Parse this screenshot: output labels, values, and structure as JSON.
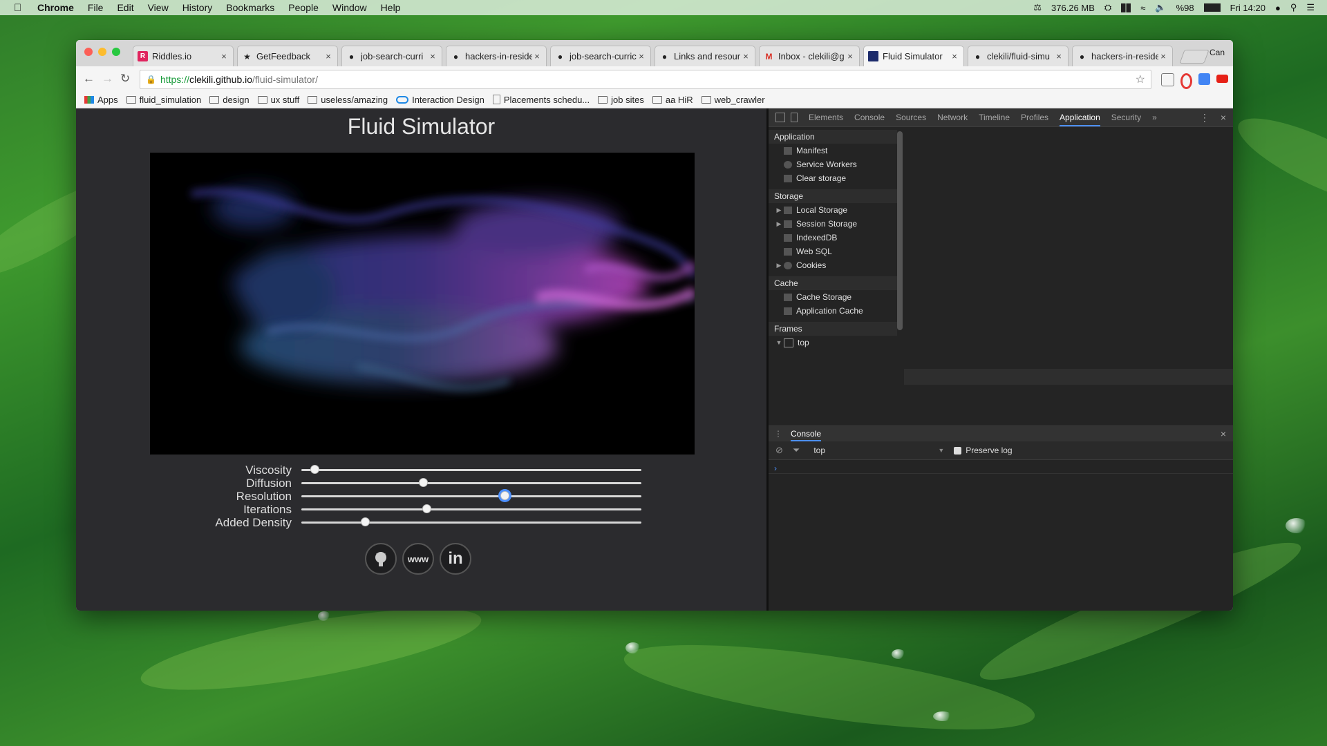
{
  "menubar": {
    "app": "Chrome",
    "items": [
      "File",
      "Edit",
      "View",
      "History",
      "Bookmarks",
      "People",
      "Window",
      "Help"
    ],
    "memory": "376.26 MB",
    "battery": "%98",
    "clock": "Fri 14:20"
  },
  "tabs": [
    {
      "label": "Riddles.io",
      "icon": "riddles-icon"
    },
    {
      "label": "GetFeedback",
      "icon": "star-icon"
    },
    {
      "label": "job-search-curri",
      "icon": "github-icon"
    },
    {
      "label": "hackers-in-reside",
      "icon": "github-icon"
    },
    {
      "label": "job-search-curric",
      "icon": "github-icon"
    },
    {
      "label": "Links and resour",
      "icon": "github-icon"
    },
    {
      "label": "Inbox - clekili@g",
      "icon": "gmail-icon"
    },
    {
      "label": "Fluid Simulator",
      "icon": "page-icon"
    },
    {
      "label": "clekili/fluid-simu",
      "icon": "github-icon"
    },
    {
      "label": "hackers-in-reside",
      "icon": "github-icon"
    }
  ],
  "profile": "Can",
  "url": {
    "scheme": "https://",
    "host": "clekili.github.io",
    "path": "/fluid-simulator/"
  },
  "bookmarks": [
    {
      "label": "Apps",
      "icon": "apps-icon"
    },
    {
      "label": "fluid_simulation",
      "icon": "folder-icon"
    },
    {
      "label": "design",
      "icon": "folder-icon"
    },
    {
      "label": "ux stuff",
      "icon": "folder-icon"
    },
    {
      "label": "useless/amazing",
      "icon": "folder-icon"
    },
    {
      "label": "Interaction Design",
      "icon": "link-icon"
    },
    {
      "label": "Placements schedu...",
      "icon": "page-icon"
    },
    {
      "label": "job sites",
      "icon": "folder-icon"
    },
    {
      "label": "aa HiR",
      "icon": "folder-icon"
    },
    {
      "label": "web_crawler",
      "icon": "folder-icon"
    }
  ],
  "page": {
    "title": "Fluid Simulator",
    "controls": [
      {
        "label": "Viscosity",
        "value": 0.04
      },
      {
        "label": "Diffusion",
        "value": 0.36
      },
      {
        "label": "Resolution",
        "value": 0.6
      },
      {
        "label": "Iterations",
        "value": 0.37
      },
      {
        "label": "Added Density",
        "value": 0.19
      }
    ],
    "social": [
      {
        "label": "",
        "icon": "github-icon"
      },
      {
        "label": "www",
        "icon": "www-icon"
      },
      {
        "label": "in",
        "icon": "linkedin-icon"
      }
    ]
  },
  "devtools": {
    "tabs": [
      "Elements",
      "Console",
      "Sources",
      "Network",
      "Timeline",
      "Profiles",
      "Application",
      "Security"
    ],
    "active_tab": "Application",
    "sections": [
      {
        "title": "Application",
        "items": [
          {
            "label": "Manifest",
            "expandable": false
          },
          {
            "label": "Service Workers",
            "expandable": false
          },
          {
            "label": "Clear storage",
            "expandable": false
          }
        ]
      },
      {
        "title": "Storage",
        "items": [
          {
            "label": "Local Storage",
            "expandable": true
          },
          {
            "label": "Session Storage",
            "expandable": true
          },
          {
            "label": "IndexedDB",
            "expandable": false
          },
          {
            "label": "Web SQL",
            "expandable": false
          },
          {
            "label": "Cookies",
            "expandable": true
          }
        ]
      },
      {
        "title": "Cache",
        "items": [
          {
            "label": "Cache Storage",
            "expandable": false
          },
          {
            "label": "Application Cache",
            "expandable": false
          }
        ]
      },
      {
        "title": "Frames",
        "items": [
          {
            "label": "top",
            "expandable": true
          }
        ]
      }
    ],
    "drawer": {
      "title": "Console",
      "context": "top",
      "preserve_log": "Preserve log",
      "prompt": "›"
    }
  },
  "colors": {
    "accent": "#4d90fe",
    "page_bg": "#2b2b2e",
    "devtools_bg": "#242424",
    "secure": "#1a9b3b"
  }
}
